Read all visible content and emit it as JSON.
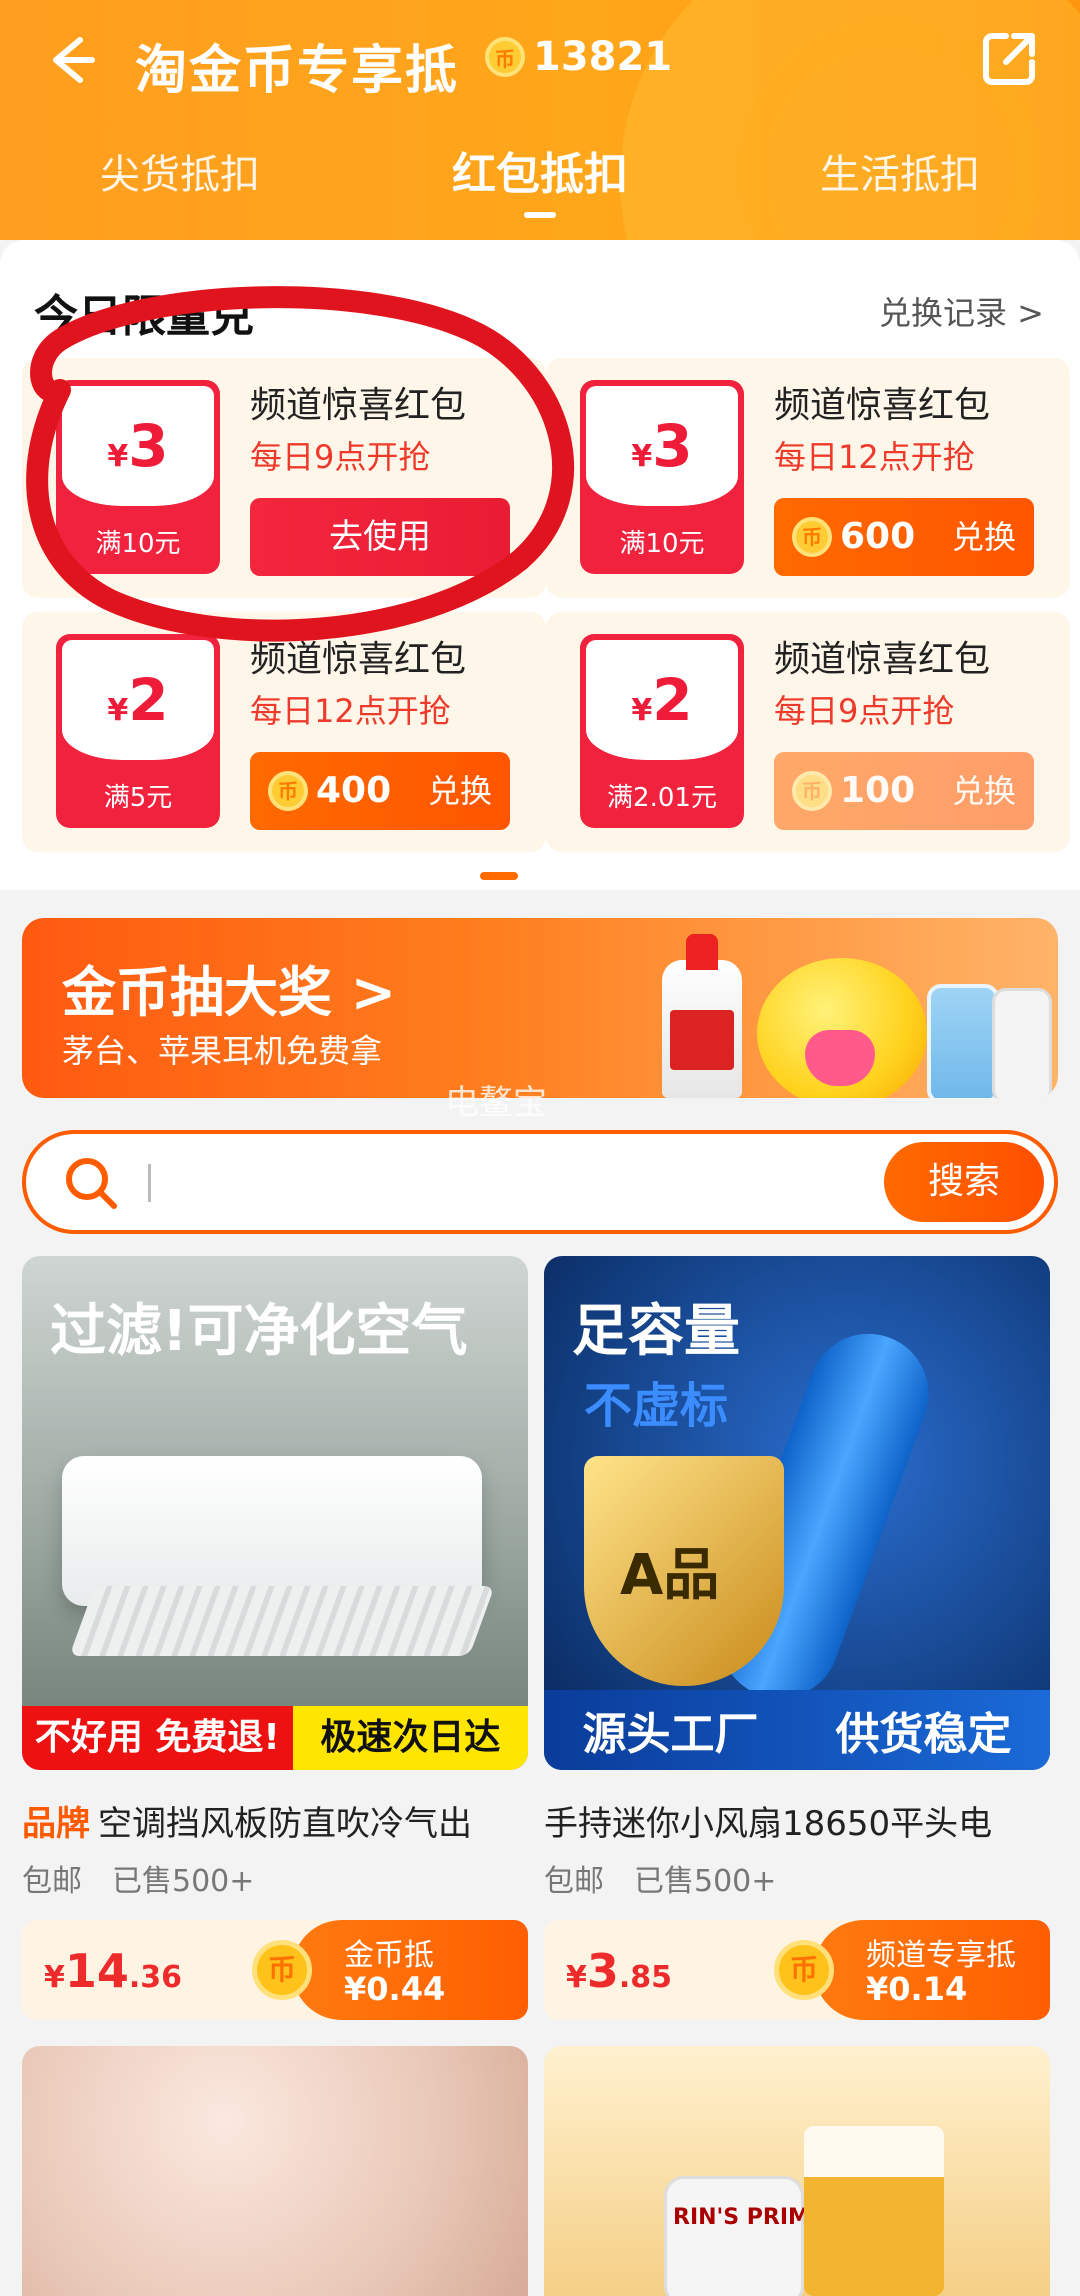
{
  "header": {
    "title": "淘金币专享抵",
    "balance": "13821",
    "coin_glyph": "币",
    "tabs": [
      {
        "label": "尖货抵扣"
      },
      {
        "label": "红包抵扣"
      },
      {
        "label": "生活抵扣"
      }
    ],
    "active_tab": 1,
    "icons": {
      "back": "back-arrow-icon",
      "share": "share-icon"
    }
  },
  "section": {
    "title": "今日限量兑",
    "record_label": "兑换记录 >"
  },
  "coupons": [
    {
      "amount": "3",
      "currency": "¥",
      "condition": "满10元",
      "name": "频道惊喜红包",
      "time": "每日9点开抢",
      "action": "去使用",
      "type": "use"
    },
    {
      "amount": "3",
      "currency": "¥",
      "condition": "满10元",
      "name": "频道惊喜红包",
      "time": "每日12点开抢",
      "points": "600",
      "action": "兑换",
      "type": "exchange"
    },
    {
      "amount": "2",
      "currency": "¥",
      "condition": "满5元",
      "name": "频道惊喜红包",
      "time": "每日12点开抢",
      "points": "400",
      "action": "兑换",
      "type": "exchange"
    },
    {
      "amount": "2",
      "currency": "¥",
      "condition": "满2.01元",
      "name": "频道惊喜红包",
      "time": "每日9点开抢",
      "points": "100",
      "action": "兑换",
      "type": "exchange-disabled"
    }
  ],
  "banner": {
    "title": "金币抽大奖 >",
    "subtitle": "茅台、苹果耳机免费拿",
    "watermark": "电鳌宝"
  },
  "search": {
    "placeholder": "",
    "button_label": "搜索"
  },
  "products": [
    {
      "image_headline": "过滤!可净化空气",
      "image_strip_left": "不好用 免费退!",
      "image_strip_right": "极速次日达",
      "brand_tag": "品牌",
      "name": "空调挡风板防直吹冷气出",
      "shipping": "包邮",
      "sold": "已售500+",
      "price_symbol": "¥",
      "price_int": "14",
      "price_dec": ".36",
      "deduct_label": "金币抵",
      "deduct_value": "¥0.44"
    },
    {
      "image_headline": "足容量",
      "image_sub": "不虚标",
      "image_badge": "A品",
      "image_strip_left": "源头工厂",
      "image_strip_right": "供货稳定",
      "brand_tag": "",
      "name": "手持迷你小风扇18650平头电",
      "shipping": "包邮",
      "sold": "已售500+",
      "price_symbol": "¥",
      "price_int": "3",
      "price_dec": ".85",
      "deduct_label": "频道专享抵",
      "deduct_value": "¥0.14"
    }
  ],
  "bottom_products": [
    {
      "image_text": ""
    },
    {
      "image_text": "RIN'S PRIME BE"
    }
  ],
  "colors": {
    "brand_orange": "#ff9e1f",
    "accent_red": "#ee1c39",
    "action_orange": "#ff6a00",
    "annotation_red": "#e0141e"
  }
}
